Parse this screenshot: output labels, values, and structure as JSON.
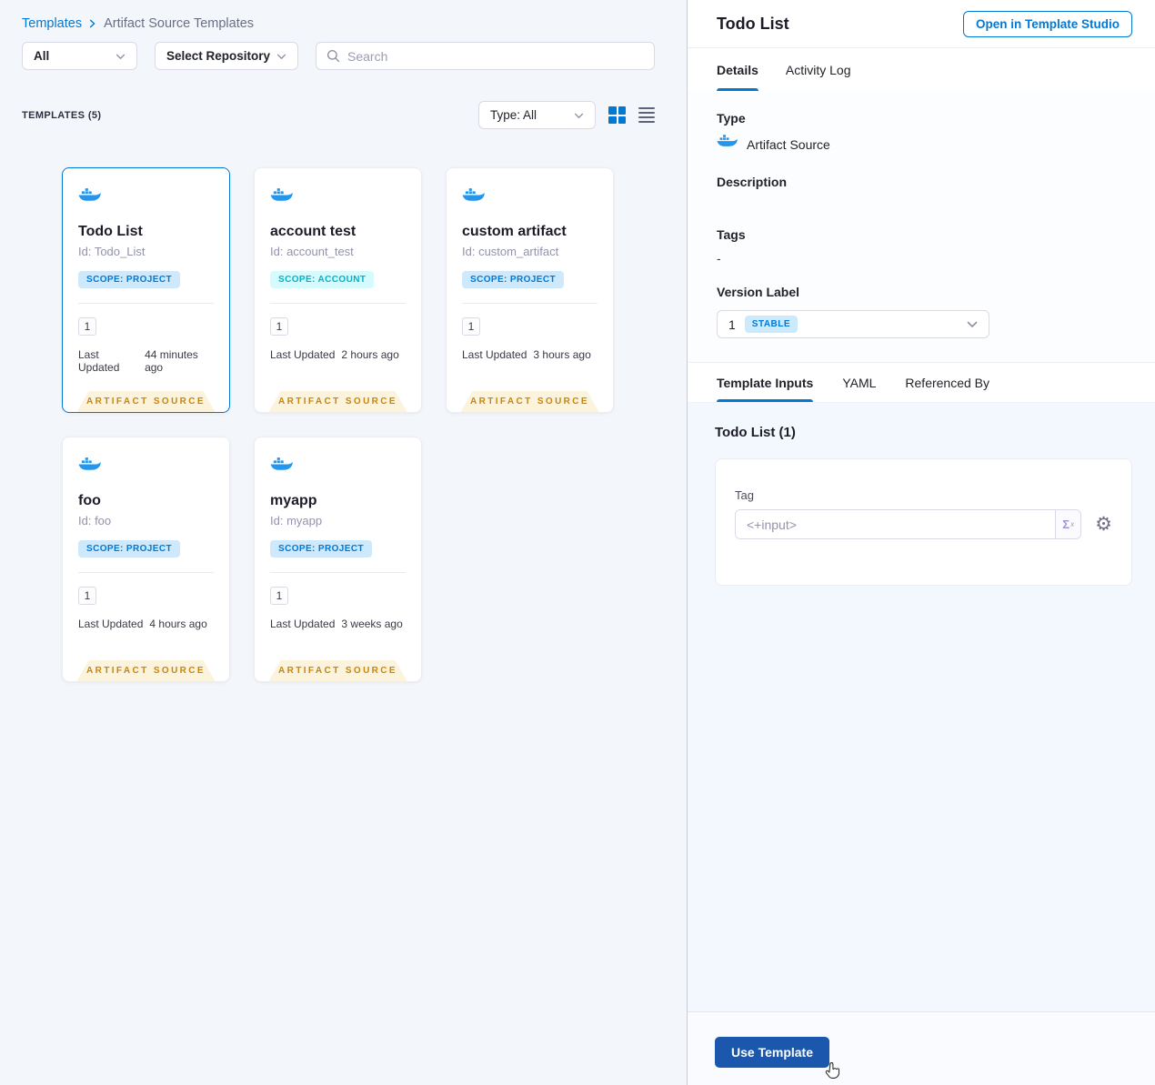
{
  "colors": {
    "primary_blue": "#0278D5",
    "docker_blue": "#2396ED",
    "use_template_bg": "#1B57AD",
    "ribbon_bg": "#FCF3DC",
    "ribbon_text": "#C7860E",
    "scope_project_bg": "#CDE9FB",
    "scope_project_text": "#0278D5",
    "scope_account_bg": "#D5FBFF",
    "scope_account_text": "#0BB0C4",
    "stable_badge_bg": "#CBEAFE",
    "stable_badge_text": "#0278D5"
  },
  "breadcrumb": {
    "root": "Templates",
    "current": "Artifact Source Templates"
  },
  "filters": {
    "scope": "All",
    "repository": "Select Repository",
    "search_placeholder": "Search"
  },
  "list_header": {
    "count": "TEMPLATES (5)",
    "type_filter": "Type: All"
  },
  "card_common": {
    "updated_label": "Last Updated",
    "footer": "ARTIFACT SOURCE"
  },
  "cards": [
    {
      "title": "Todo List",
      "id": "Id: Todo_List",
      "scope": "SCOPE: PROJECT",
      "scope_type": "project",
      "version": "1",
      "updated": "44 minutes ago"
    },
    {
      "title": "account test",
      "id": "Id: account_test",
      "scope": "SCOPE: ACCOUNT",
      "scope_type": "account",
      "version": "1",
      "updated": "2 hours ago"
    },
    {
      "title": "custom artifact",
      "id": "Id: custom_artifact",
      "scope": "SCOPE: PROJECT",
      "scope_type": "project",
      "version": "1",
      "updated": "3 hours ago"
    },
    {
      "title": "foo",
      "id": "Id: foo",
      "scope": "SCOPE: PROJECT",
      "scope_type": "project",
      "version": "1",
      "updated": "4 hours ago"
    },
    {
      "title": "myapp",
      "id": "Id: myapp",
      "scope": "SCOPE: PROJECT",
      "scope_type": "project",
      "version": "1",
      "updated": "3 weeks ago"
    }
  ],
  "details_panel": {
    "title": "Todo List",
    "open_studio": "Open in Template Studio",
    "tabs": {
      "details": "Details",
      "activity_log": "Activity Log"
    },
    "fields": {
      "type_label": "Type",
      "type_value": "Artifact Source",
      "description_label": "Description",
      "tags_label": "Tags",
      "tags_value": "-",
      "version_label": "Version Label",
      "version_value": "1",
      "version_badge": "STABLE"
    },
    "inputs_tabs": {
      "template_inputs": "Template Inputs",
      "yaml": "YAML",
      "referenced_by": "Referenced By"
    },
    "inputs_heading": "Todo List (1)",
    "tag_field": {
      "label": "Tag",
      "value": "<+input>",
      "expression_symbol": "Σ",
      "expression_sub": "x"
    },
    "use_template": "Use Template"
  }
}
